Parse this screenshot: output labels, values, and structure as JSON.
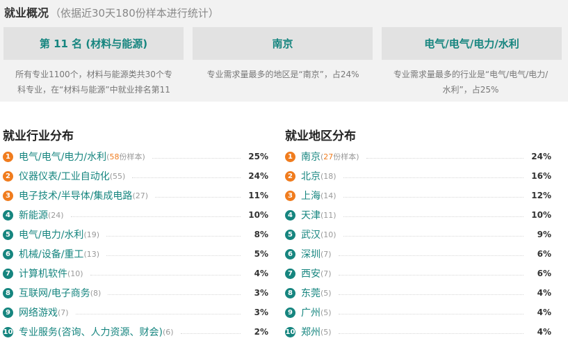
{
  "overview": {
    "title": "就业概况",
    "subtitle": "（依据近30天180份样本进行统计）",
    "cards": [
      {
        "label": "第 11 名 (材料与能源)"
      },
      {
        "label": "南京"
      },
      {
        "label": "电气/电气/电力/水利"
      }
    ],
    "descriptions": [
      {
        "line1": "所有专业1100个，材料与能源类共30个专",
        "line2": "科专业，在“材料与能源”中就业排名第11"
      },
      {
        "line1": "专业需求量最多的地区是“南京”，占24%",
        "line2": ""
      },
      {
        "line1": "专业需求量最多的行业是“电气/电气/电力/",
        "line2": "水利”，占25%"
      }
    ]
  },
  "industry": {
    "title": "就业行业分布",
    "items": [
      {
        "rank": "1",
        "name": "电气/电气/电力/水利",
        "count_pre": "(",
        "count": "58",
        "count_suffix": "份样本)",
        "pct": "25%"
      },
      {
        "rank": "2",
        "name": "仪器仪表/工业自动化",
        "count": "(55)",
        "pct": "24%"
      },
      {
        "rank": "3",
        "name": "电子技术/半导体/集成电路",
        "count": "(27)",
        "pct": "11%"
      },
      {
        "rank": "4",
        "name": "新能源",
        "count": "(24)",
        "pct": "10%"
      },
      {
        "rank": "5",
        "name": "电气/电力/水利",
        "count": "(19)",
        "pct": "8%"
      },
      {
        "rank": "6",
        "name": "机械/设备/重工",
        "count": "(13)",
        "pct": "5%"
      },
      {
        "rank": "7",
        "name": "计算机软件",
        "count": "(10)",
        "pct": "4%"
      },
      {
        "rank": "8",
        "name": "互联网/电子商务",
        "count": "(8)",
        "pct": "3%"
      },
      {
        "rank": "9",
        "name": "网络游戏",
        "count": "(7)",
        "pct": "3%"
      },
      {
        "rank": "10",
        "name": "专业服务(咨询、人力资源、财会)",
        "count": "(6)",
        "pct": "2%"
      }
    ]
  },
  "region": {
    "title": "就业地区分布",
    "items": [
      {
        "rank": "1",
        "name": "南京",
        "count_pre": "(",
        "count": "27",
        "count_suffix": "份样本)",
        "pct": "24%"
      },
      {
        "rank": "2",
        "name": "北京",
        "count": "(18)",
        "pct": "16%"
      },
      {
        "rank": "3",
        "name": "上海",
        "count": "(14)",
        "pct": "12%"
      },
      {
        "rank": "4",
        "name": "天津",
        "count": "(11)",
        "pct": "10%"
      },
      {
        "rank": "5",
        "name": "武汉",
        "count": "(10)",
        "pct": "9%"
      },
      {
        "rank": "6",
        "name": "深圳",
        "count": "(7)",
        "pct": "6%"
      },
      {
        "rank": "7",
        "name": "西安",
        "count": "(7)",
        "pct": "6%"
      },
      {
        "rank": "8",
        "name": "东莞",
        "count": "(5)",
        "pct": "4%"
      },
      {
        "rank": "9",
        "name": "广州",
        "count": "(5)",
        "pct": "4%"
      },
      {
        "rank": "10",
        "name": "郑州",
        "count": "(5)",
        "pct": "4%"
      }
    ]
  },
  "colors": {
    "accent": "#16857f",
    "highlight": "#f07c1e"
  }
}
